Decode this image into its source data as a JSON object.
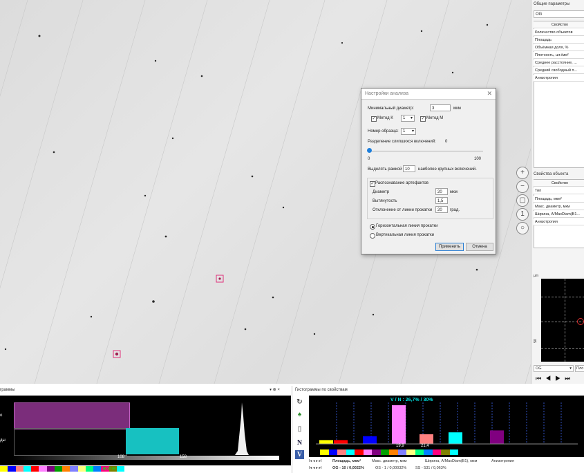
{
  "dialog": {
    "title": "Настройки анализа",
    "min_diameter_label": "Минимальный диаметр:",
    "min_diameter_value": "3",
    "min_diameter_unit": "мкм",
    "method_k_label": "Метод К",
    "method_k_value": "1",
    "method_m_label": "Метод М",
    "sample_number_label": "Номер образца:",
    "sample_number_value": "1",
    "separation_label": "Разделение слипшихся включений:",
    "separation_value": "0",
    "slider_min": "0",
    "slider_max": "100",
    "slider_level": 0,
    "highlight_prefix": "Выделять рамкой",
    "highlight_value": "10",
    "highlight_suffix": "наиболее крупных включений.",
    "artifact_label": "Распознавание артефактов",
    "diameter_label": "Диаметр",
    "diameter_value": "20",
    "diameter_unit": "мкм",
    "elongation_label": "Вытянутость",
    "elongation_value": "1,5",
    "deviation_label": "Отклонение от линии прокатки",
    "deviation_value": "20",
    "deviation_unit": "град.",
    "radio_horizontal": "Горизонтальная линия прокатки",
    "radio_vertical": "Вертикальная линия прокатки",
    "apply_button": "Применить",
    "cancel_button": "Отмена"
  },
  "right_panel": {
    "general_title": "Общие параметры",
    "combo_value": "OG",
    "property_header": "Свойство",
    "general_rows": [
      "Количество объектов",
      "Площадь",
      "Объёмная доля, %",
      "Плотность, шт./мм²",
      "Среднее расстояние, ...",
      "Средний свободный п...",
      "Анизотропия"
    ],
    "object_title": "Свойства объекта",
    "object_header": "Свойство",
    "object_rows": [
      "Тип",
      "Площадь, мкм²",
      "Макс. диаметр, мкм",
      "Ширина, A/MaxDiam(B1...",
      "Анизотропия"
    ],
    "plot_axis_label": "µm",
    "plot_tick": "50",
    "bottom_combo": "OG",
    "bottom_combo2": "Пло"
  },
  "bottom_left": {
    "title": "граммы",
    "label_1": "о",
    "label_2": "ды",
    "tick_1": "108",
    "tick_2": "158",
    "controls": "▾  ⊕  ×"
  },
  "bottom_right": {
    "title": "Гистограммы по свойствам",
    "chart_caption": "V / N : 26,7% / 30%",
    "value_1": "19,9",
    "value_2": "21,4",
    "tabs_row1": [
      "Площадь, мкм²",
      "Макс. диаметр, мкм",
      "Ширина, A/MaxDiam(B1), мкм",
      "Анизотропия"
    ],
    "tabs_row2": [
      "OG - 10 / 0,0022%",
      "OS - 1 / 0,00032%",
      "SS - 531 / 0,063%"
    ],
    "tool_n": "N",
    "tool_v": "V"
  },
  "chart_data": {
    "type": "bar",
    "title": "V / N : 26,7% / 30%",
    "series": [
      {
        "values": [
          10,
          10,
          20,
          100,
          25,
          30,
          35,
          35,
          25,
          10
        ]
      }
    ],
    "colors": [
      "#ffff00",
      "#ff0000",
      "#0000ff",
      "#ff80ff",
      "#ff8080",
      "#00ffff",
      "#800080"
    ],
    "ylim": [
      0,
      100
    ]
  }
}
